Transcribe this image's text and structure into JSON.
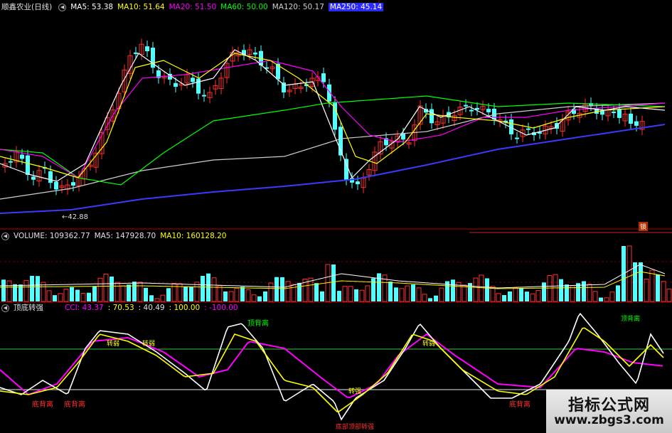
{
  "price_header": {
    "title": "顺鑫农业(日线)",
    "ma5": "MA5: 53.38",
    "ma10": "MA10: 51.64",
    "ma20": "MA20: 51.50",
    "ma60": "MA60: 50.00",
    "ma120": "MA120: 50.17",
    "ma250": "MA250: 45.14"
  },
  "price_low_label": "42.88",
  "corner_badge": "锁",
  "volume_header": {
    "title": "VOLUME: 109362.77",
    "ma5": "MA5: 147928.70",
    "ma10": "MA10: 160128.20"
  },
  "indicator_header": {
    "title": "顶底转强",
    "cci": "CCI: 43.37",
    "v2": ": 70.53",
    "v3": ": 40.49",
    "v4": ": 100.00",
    "v5": ": -100.00"
  },
  "signals": {
    "top_divergence_1": "顶背离",
    "top_divergence_2": "顶背离",
    "bottom_divergence_1": "底背离",
    "bottom_divergence_2": "底背离",
    "bottom_divergence_3": "底背离",
    "bottom_strong": "底部顶部转强",
    "t1": "转弱",
    "t2": "转弱",
    "t3": "转强",
    "t4": "转弱"
  },
  "watermark": {
    "name": "指标公式网",
    "url": "www.zbgs3.com"
  },
  "colors": {
    "up": "#ff3030",
    "down": "#54ffff",
    "ma5": "#ffffff",
    "ma10": "#ffff00",
    "ma20": "#ff00ff",
    "ma60": "#00ff00",
    "ma120": "#cccccc",
    "ma250": "#3a3aff",
    "grid": "#8b0000"
  }
}
